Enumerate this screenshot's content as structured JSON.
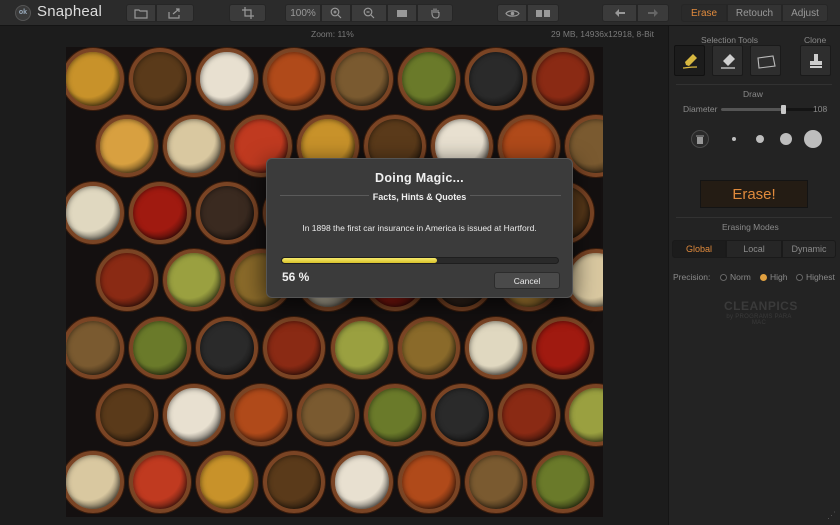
{
  "app": {
    "logo_text": "ok",
    "title": "Snapheal"
  },
  "toolbar": {
    "open_icon": "folder-icon",
    "share_icon": "share-icon",
    "crop_icon": "crop-icon",
    "zoom_label": "100%",
    "zoom_in_icon": "zoom-in-icon",
    "zoom_out_icon": "zoom-out-icon",
    "fit_icon": "fit-screen-icon",
    "hand_icon": "hand-icon",
    "preview_icon": "eye-icon",
    "compare_icon": "compare-icon",
    "undo_icon": "undo-icon",
    "redo_icon": "redo-icon",
    "modes": [
      "Erase",
      "Retouch",
      "Adjust"
    ],
    "active_mode": "Erase"
  },
  "status": {
    "zoom": "Zoom: 11%",
    "file_info": "29 MB, 14936x12918, 8-Bit"
  },
  "panel": {
    "selection_tools_label": "Selection Tools",
    "clone_label": "Clone",
    "draw_label": "Draw",
    "diameter_label": "Diameter",
    "diameter_value": "108",
    "diameter_fraction": 0.62,
    "erase_button": "Erase!",
    "erasing_modes_label": "Erasing Modes",
    "erasing_modes": [
      "Global",
      "Local",
      "Dynamic"
    ],
    "active_erasing_mode": "Global",
    "precision_label": "Precision:",
    "precision_options": [
      "Norm",
      "High",
      "Highest"
    ],
    "active_precision": "High",
    "watermark_main": "CLEANPICS",
    "watermark_sub": "by PROGRAMS PARA MAC"
  },
  "modal": {
    "title": "Doing Magic...",
    "subtitle": "Facts, Hints & Quotes",
    "fact": "In 1898 the first car insurance in America is issued at Hartford.",
    "progress_percent": 56,
    "progress_label": "56 %",
    "cancel_label": "Cancel"
  },
  "colors": {
    "accent": "#e08a3c",
    "progress": "#f0de4a",
    "toolbar_bg": "#2b2b2b",
    "panel_bg": "#232323"
  }
}
